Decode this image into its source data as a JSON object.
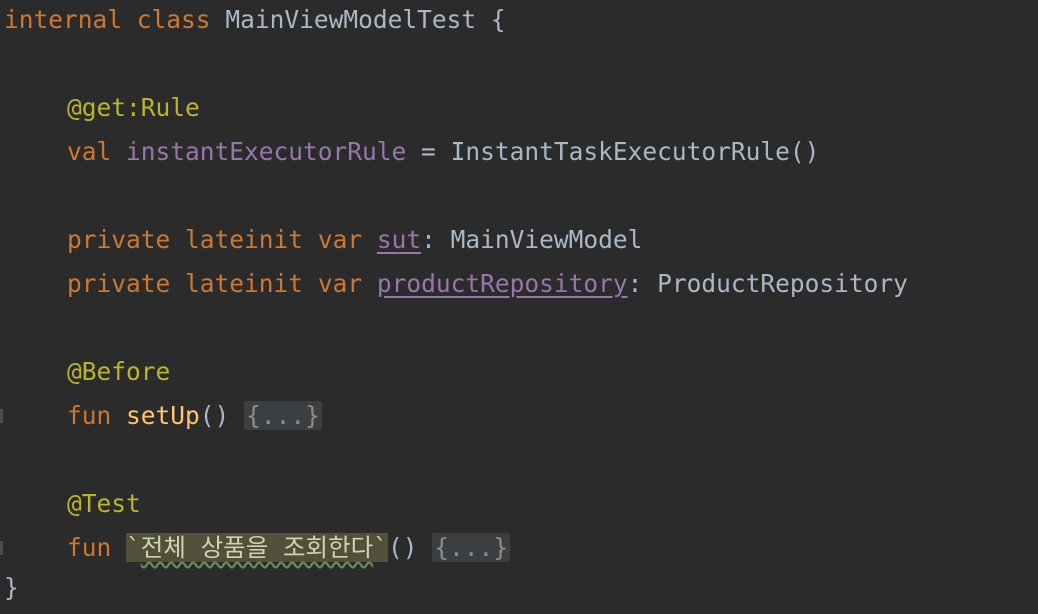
{
  "code": {
    "class_decl": {
      "kw_internal": "internal",
      "kw_class": "class",
      "name": "MainViewModelTest",
      "brace": "{"
    },
    "rule_annotation": "@get:Rule",
    "rule_line": {
      "kw_val": "val",
      "name": "instantExecutorRule",
      "eq": " = ",
      "value": "InstantTaskExecutorRule()"
    },
    "sut_line": {
      "kw_private": "private",
      "kw_lateinit": "lateinit",
      "kw_var": "var",
      "name": "sut",
      "type": ": MainViewModel"
    },
    "repo_line": {
      "kw_private": "private",
      "kw_lateinit": "lateinit",
      "kw_var": "var",
      "name": "productRepository",
      "type": ": ProductRepository"
    },
    "before_annotation": "@Before",
    "setup_line": {
      "kw_fun": "fun",
      "name": "setUp",
      "parens": "()",
      "folded": "{...}"
    },
    "test_annotation": "@Test",
    "test_line": {
      "kw_fun": "fun",
      "tick_open": "`",
      "name": "전체 상품을 조회한다",
      "tick_close": "`",
      "parens": "()",
      "folded": "{...}"
    },
    "close_brace": "}"
  },
  "colors": {
    "background": "#2b2b2b",
    "keyword": "#cc7832",
    "annotation": "#bbb529",
    "property": "#9876aa",
    "function": "#ffc66d",
    "text": "#a9b7c6"
  }
}
